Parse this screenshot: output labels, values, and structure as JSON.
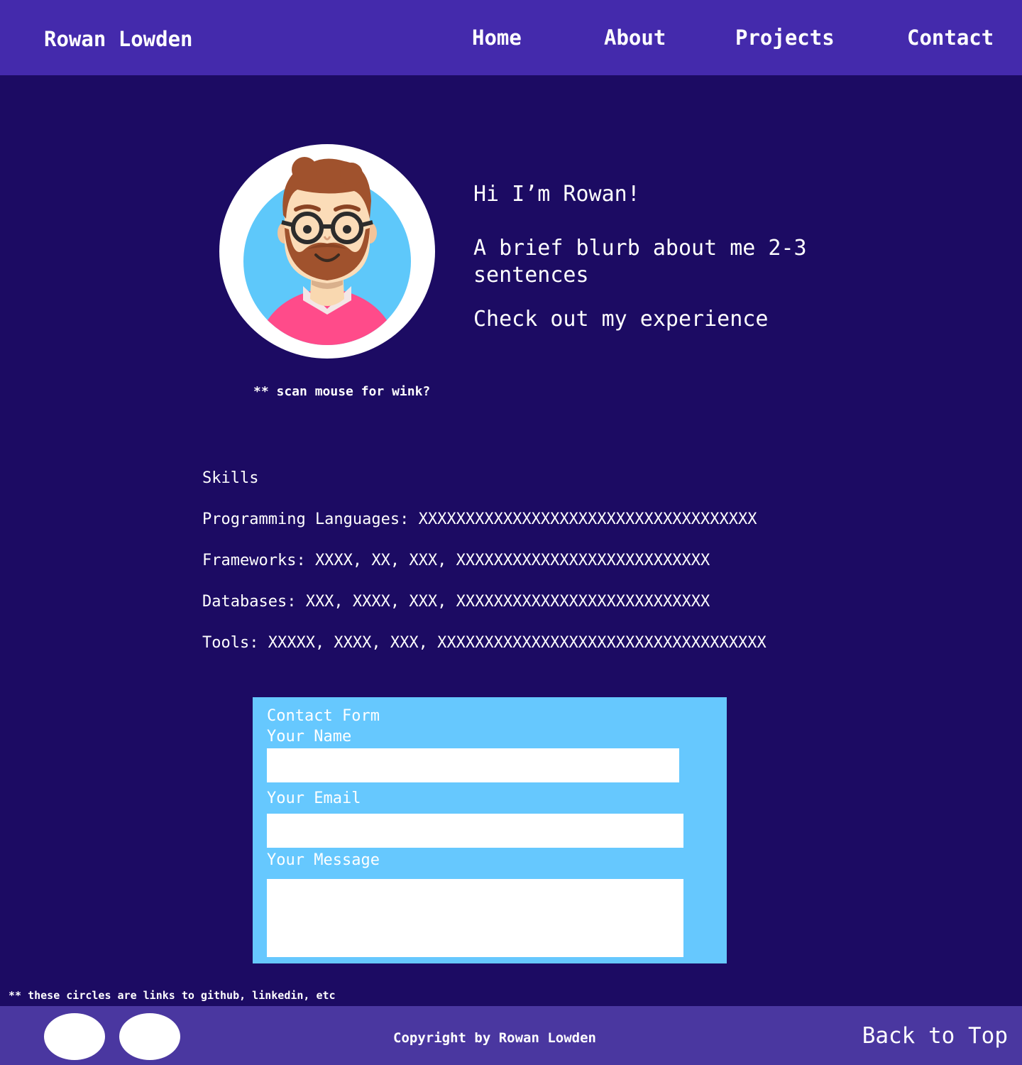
{
  "navbar": {
    "brand": "Rowan Lowden",
    "links": [
      "Home",
      "About",
      "Projects",
      "Contact"
    ]
  },
  "hero": {
    "greeting": "Hi I’m Rowan!",
    "blurb": "A brief blurb about me 2-3 sentences",
    "cta": "Check out my experience",
    "avatar_icon": "bearded-man-with-glasses-avatar",
    "wink_note": "** scan mouse for wink?"
  },
  "skills": {
    "title": "Skills",
    "rows": [
      "Programming Languages: XXXXXXXXXXXXXXXXXXXXXXXXXXXXXXXXXXXX",
      "Frameworks: XXXX, XX, XXX, XXXXXXXXXXXXXXXXXXXXXXXXXXX",
      "Databases: XXX, XXXX, XXX, XXXXXXXXXXXXXXXXXXXXXXXXXXX",
      "Tools: XXXXX, XXXX, XXX, XXXXXXXXXXXXXXXXXXXXXXXXXXXXXXXXXXX"
    ]
  },
  "contact_form": {
    "title": "Contact Form",
    "name_label": "Your Name",
    "name_value": "",
    "email_label": "Your Email",
    "email_value": "",
    "message_label": "Your Message",
    "message_value": ""
  },
  "footer": {
    "note": "** these circles are links to github, linkedin, etc",
    "social_links": [
      "github-link",
      "linkedin-link"
    ],
    "copyright": "Copyright by Rowan Lowden",
    "back_to_top": "Back to Top"
  },
  "colors": {
    "page_bg": "#1c0b63",
    "navbar_bg": "#442aac",
    "footer_bg": "#4a37a0",
    "form_bg": "#66c8fe",
    "avatar_bg": "#5ec8fa",
    "shirt": "#ff4b8a",
    "hair": "#a0522d"
  }
}
